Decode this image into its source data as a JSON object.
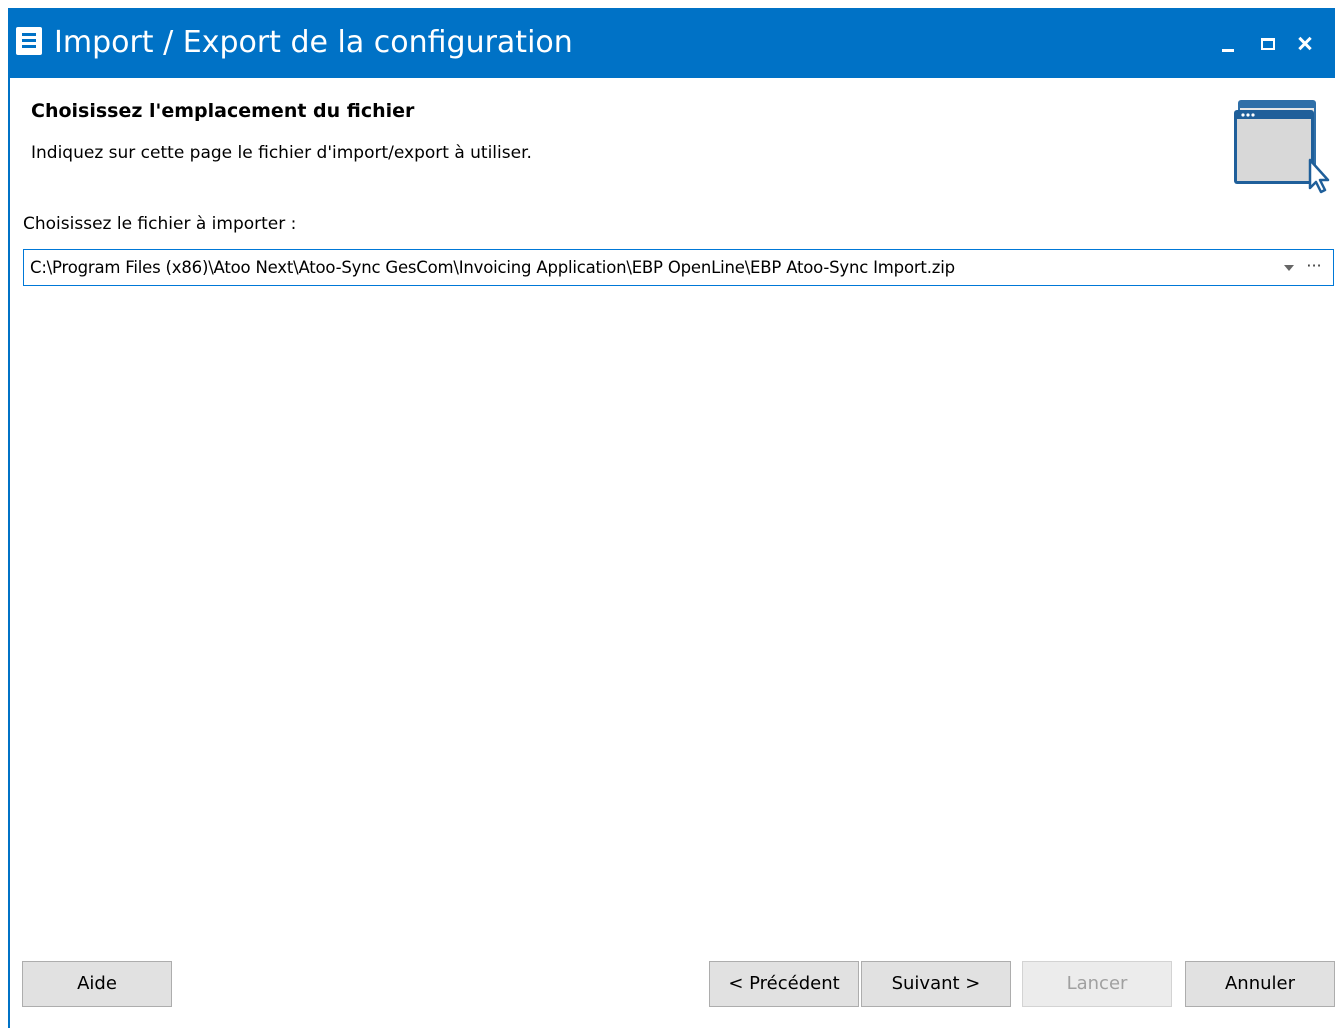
{
  "window": {
    "title": "Import / Export de la configuration"
  },
  "header": {
    "heading": "Choisissez l'emplacement du fichier",
    "subtitle": "Indiquez sur cette page le fichier d'import/export à utiliser."
  },
  "file": {
    "label": "Choisissez le fichier à importer :",
    "value": "C:\\Program Files (x86)\\Atoo Next\\Atoo-Sync GesCom\\Invoicing Application\\EBP OpenLine\\EBP Atoo-Sync Import.zip",
    "browse_label": "···"
  },
  "buttons": {
    "help": "Aide",
    "previous": "< Précédent",
    "next": "Suivant >",
    "run": "Lancer",
    "cancel": "Annuler"
  },
  "colors": {
    "titlebar": "#0072c6",
    "focus_border": "#0078d7",
    "button_bg": "#e1e1e1"
  },
  "icons": {
    "app": "form-list-icon",
    "header": "window-cursor-icon"
  }
}
